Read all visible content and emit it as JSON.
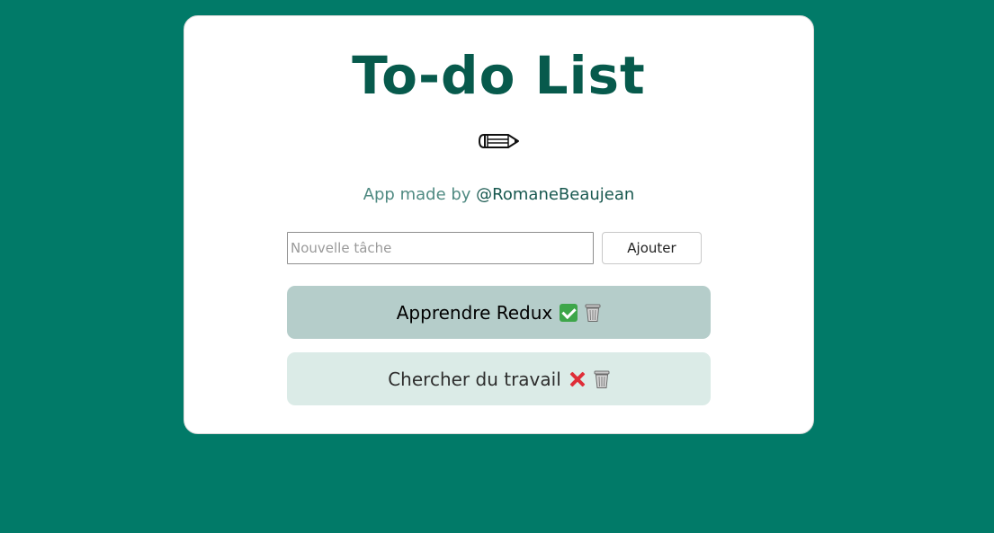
{
  "app": {
    "title": "To-do List",
    "credit_prefix": "App made by ",
    "credit_handle": "@RomaneBeaujean",
    "pencil_icon": "pencil-icon"
  },
  "form": {
    "input_value": "",
    "input_placeholder": "Nouvelle tâche",
    "add_button_label": "Ajouter"
  },
  "tasks": [
    {
      "label": "Apprendre Redux",
      "status": "done",
      "status_icon": "check-mark-icon",
      "delete_icon": "trash-icon"
    },
    {
      "label": "Chercher du travail",
      "status": "pending",
      "status_icon": "cross-mark-icon",
      "delete_icon": "trash-icon"
    }
  ],
  "colors": {
    "background": "#017a68",
    "card": "#ffffff",
    "title": "#075a4c",
    "credit_text": "#4f8a82",
    "credit_handle": "#18584f",
    "task_done_bg": "#b5cdca",
    "task_pending_bg": "#dbebe7",
    "check": "#3ea64a",
    "cross": "#df2e38"
  }
}
